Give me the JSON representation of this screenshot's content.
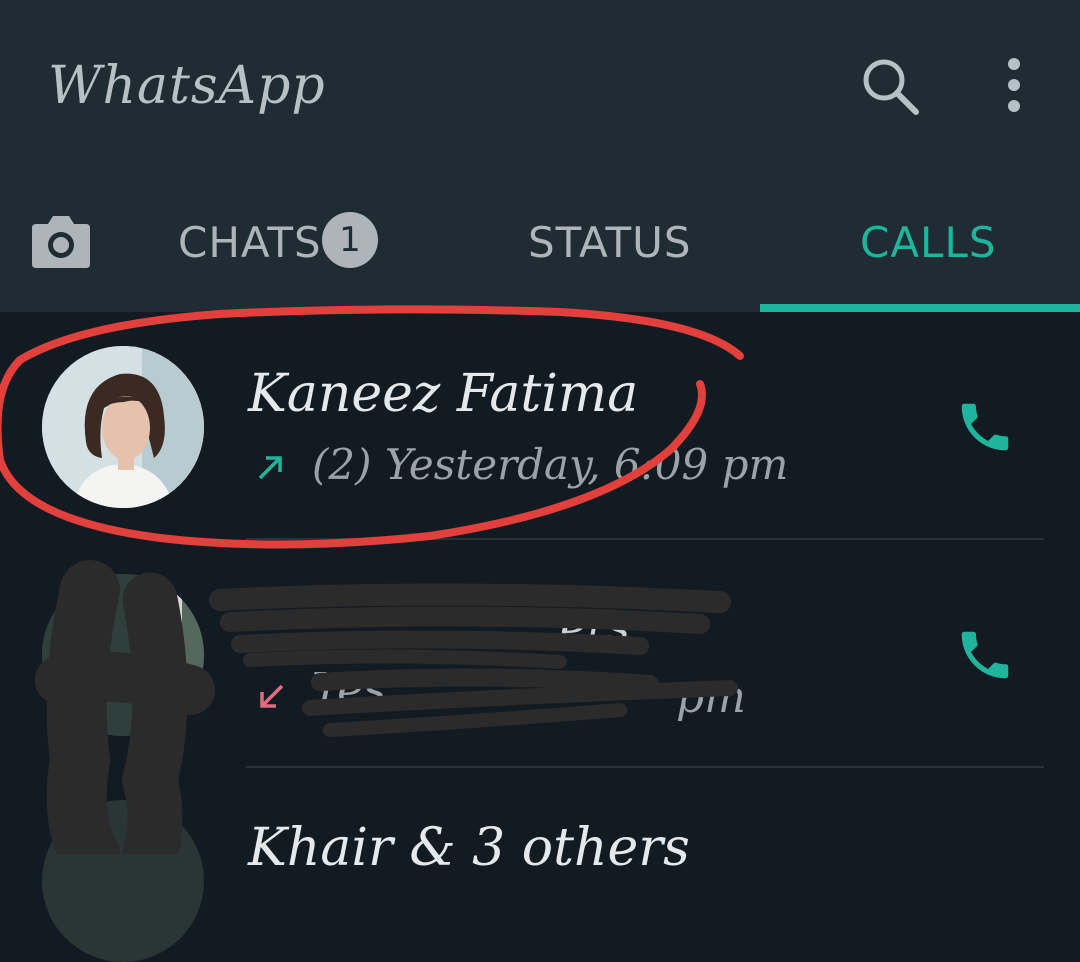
{
  "app": {
    "title": "WhatsApp"
  },
  "tabs": {
    "chats_label": "CHATS",
    "chats_badge": "1",
    "status_label": "STATUS",
    "calls_label": "CALLS"
  },
  "calls": [
    {
      "name": "Kaneez Fatima",
      "direction": "outgoing",
      "meta": "(2) Yesterday, 6:09 pm"
    },
    {
      "name_partial": "ers",
      "direction": "incoming",
      "meta_partial": "Yes",
      "meta_partial_2": "pm"
    },
    {
      "name": "Khair & 3 others"
    }
  ],
  "colors": {
    "appbar": "#1f2c34",
    "background": "#121b22",
    "accent": "#1fb59d",
    "missed_incoming": "#e26b7c",
    "annotation": "#e2403c"
  },
  "icons": [
    "camera-icon",
    "search-icon",
    "menu-icon",
    "call-icon",
    "outgoing-call-arrow-icon",
    "incoming-call-arrow-icon"
  ]
}
